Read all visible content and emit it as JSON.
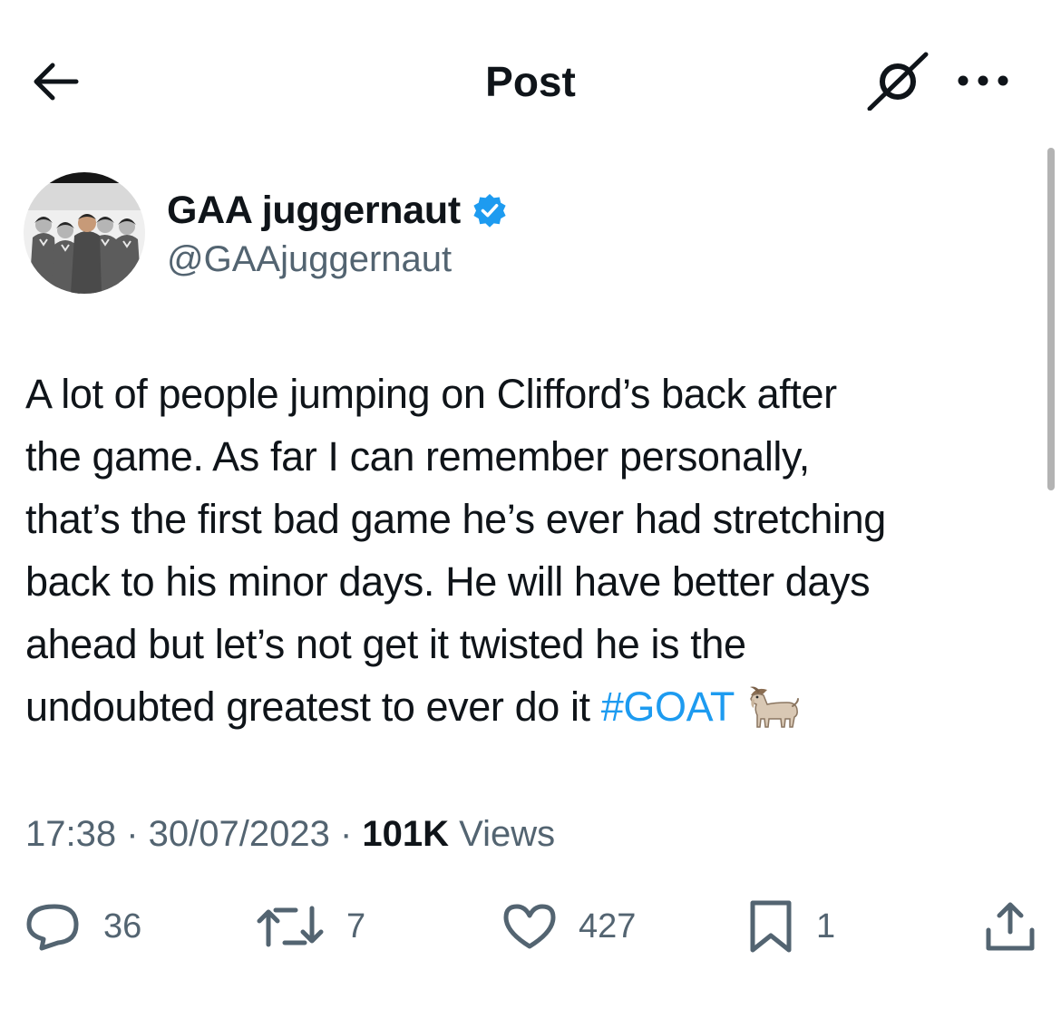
{
  "header": {
    "title": "Post",
    "back_icon": "arrow-left-icon",
    "grok_icon": "grok-icon",
    "more_icon": "more-horizontal-icon"
  },
  "author": {
    "name": "GAA juggernaut",
    "handle": "@GAAjuggernaut",
    "verified": true,
    "verified_color": "#1d9bf0"
  },
  "tweet": {
    "text": "A lot of people jumping on Clifford’s back after\nthe game. As far I can remember personally,\nthat’s the first bad game he’s ever had stretching\nback to his minor days. He will have better days\nahead but let’s not get it twisted he is the\nundoubted greatest to ever do it ",
    "hashtag": "#GOAT",
    "emoji": "goat-emoji"
  },
  "meta": {
    "time": "17:38",
    "separator": " · ",
    "date": "30/07/2023",
    "views_count": "101K",
    "views_label": " Views"
  },
  "actions": {
    "replies": "36",
    "reposts": "7",
    "likes": "427",
    "bookmarks": "1"
  },
  "colors": {
    "text": "#0f1419",
    "secondary": "#536471",
    "accent": "#1d9bf0"
  }
}
